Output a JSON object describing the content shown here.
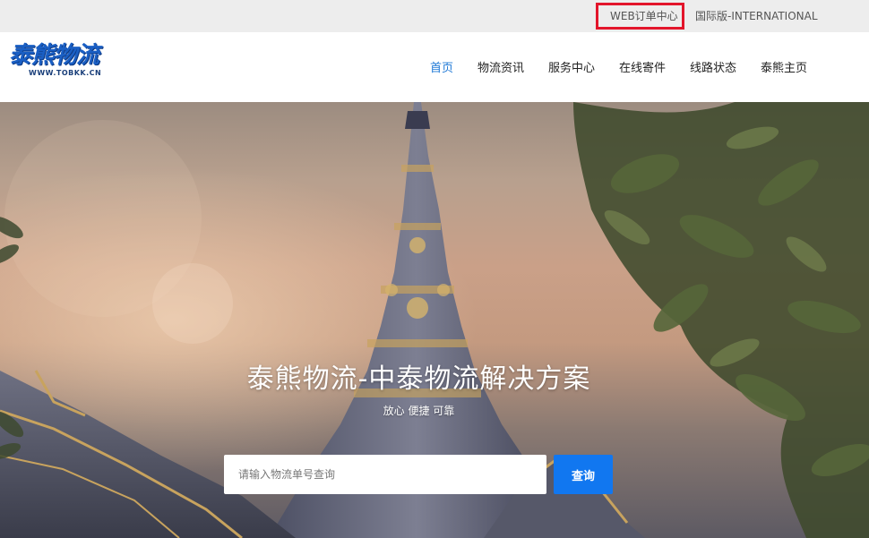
{
  "topbar": {
    "web_order_label": "WEB订单中心",
    "international_label": "国际版-INTERNATIONAL"
  },
  "logo": {
    "text": "泰熊物流",
    "subtext": "WWW.TOBKK.CN"
  },
  "nav": {
    "items": [
      {
        "label": "首页",
        "active": true
      },
      {
        "label": "物流资讯",
        "active": false
      },
      {
        "label": "服务中心",
        "active": false
      },
      {
        "label": "在线寄件",
        "active": false
      },
      {
        "label": "线路状态",
        "active": false
      },
      {
        "label": "泰熊主页",
        "active": false
      }
    ]
  },
  "hero": {
    "title": "泰熊物流-中泰物流解决方案",
    "subtitle": "放心 便捷 可靠",
    "search": {
      "placeholder": "请输入物流单号查询",
      "value": "",
      "button_label": "查询"
    }
  },
  "colors": {
    "accent": "#1e78d6",
    "button": "#1177f0",
    "highlight_box": "#e3152b",
    "topbar_bg": "#ededed"
  }
}
